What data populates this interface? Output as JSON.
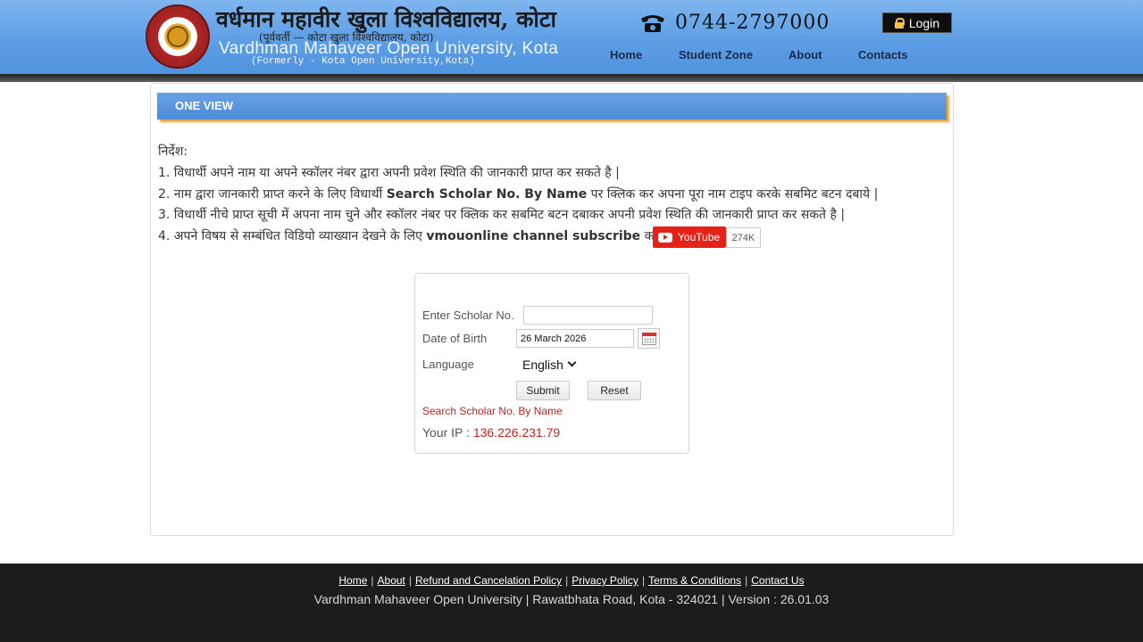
{
  "header": {
    "university_hindi": "वर्धमान महावीर खुला विश्वविद्यालय, कोटा",
    "university_hindi_sub": "(पूर्ववर्ती — कोटा खुला विश्वविद्यालय, कोटा)",
    "university_english": "Vardhman Mahaveer Open University, Kota",
    "formerly": "(Formerly - Kota Open University,Kota)",
    "phone": "0744-2797000",
    "login_label": "Login",
    "nav": [
      "Home",
      "Student Zone",
      "About",
      "Contacts"
    ]
  },
  "section_title": "ONE VIEW",
  "instructions": {
    "heading": "निर्देश:",
    "line1": "1. विधार्थी अपने नाम या अपने स्कॉलर नंबर द्वारा अपनी प्रवेश स्थिति की जानकारी प्राप्त कर सकते है |",
    "line2_prefix": "2. नाम द्वारा जानकारी प्राप्त करने के लिए विधार्थी ",
    "line2_bold": "Search Scholar No. By Name",
    "line2_suffix": " पर क्लिक कर अपना पूरा नाम टाइप करके सबमिट बटन दबाये |",
    "line3": "3. विधार्थी नीचे प्राप्त सूची में अपना नाम चुने और स्कॉलर नंबर पर क्लिक कर सबमिट बटन दबाकर अपनी प्रवेश स्थिति की जानकारी प्राप्त कर सकते है |",
    "line4_prefix": "4. अपने विषय से सम्बंधित विडियो व्याख्यान देखने के लिए ",
    "line4_bold": "vmouonline channel subscribe",
    "line4_suffix": " करें",
    "youtube_label": "YouTube",
    "youtube_count": "274K"
  },
  "form": {
    "scholar_label": "Enter Scholar No.",
    "scholar_value": "",
    "dob_label": "Date of Birth",
    "dob_value": "26 March 2026",
    "language_label": "Language",
    "language_value": "English",
    "submit_label": "Submit",
    "reset_label": "Reset",
    "search_link": "Search Scholar No. By Name",
    "ip_label": "Your IP : ",
    "ip_value": "136.226.231.79"
  },
  "footer": {
    "links": [
      "Home",
      "About",
      "Refund and Cancelation Policy",
      "Privacy Policy",
      "Terms & Conditions",
      "Contact Us"
    ],
    "info": "Vardhman Mahaveer Open University | Rawatbhata Road, Kota - 324021 | Version : 26.01.03"
  },
  "colors": {
    "header_blue": "#5fa0e6",
    "accent_red": "#cc1e1e",
    "footer_bg": "#1c1c1c",
    "youtube_red": "#e62117",
    "section_shadow": "#e5a83a"
  }
}
